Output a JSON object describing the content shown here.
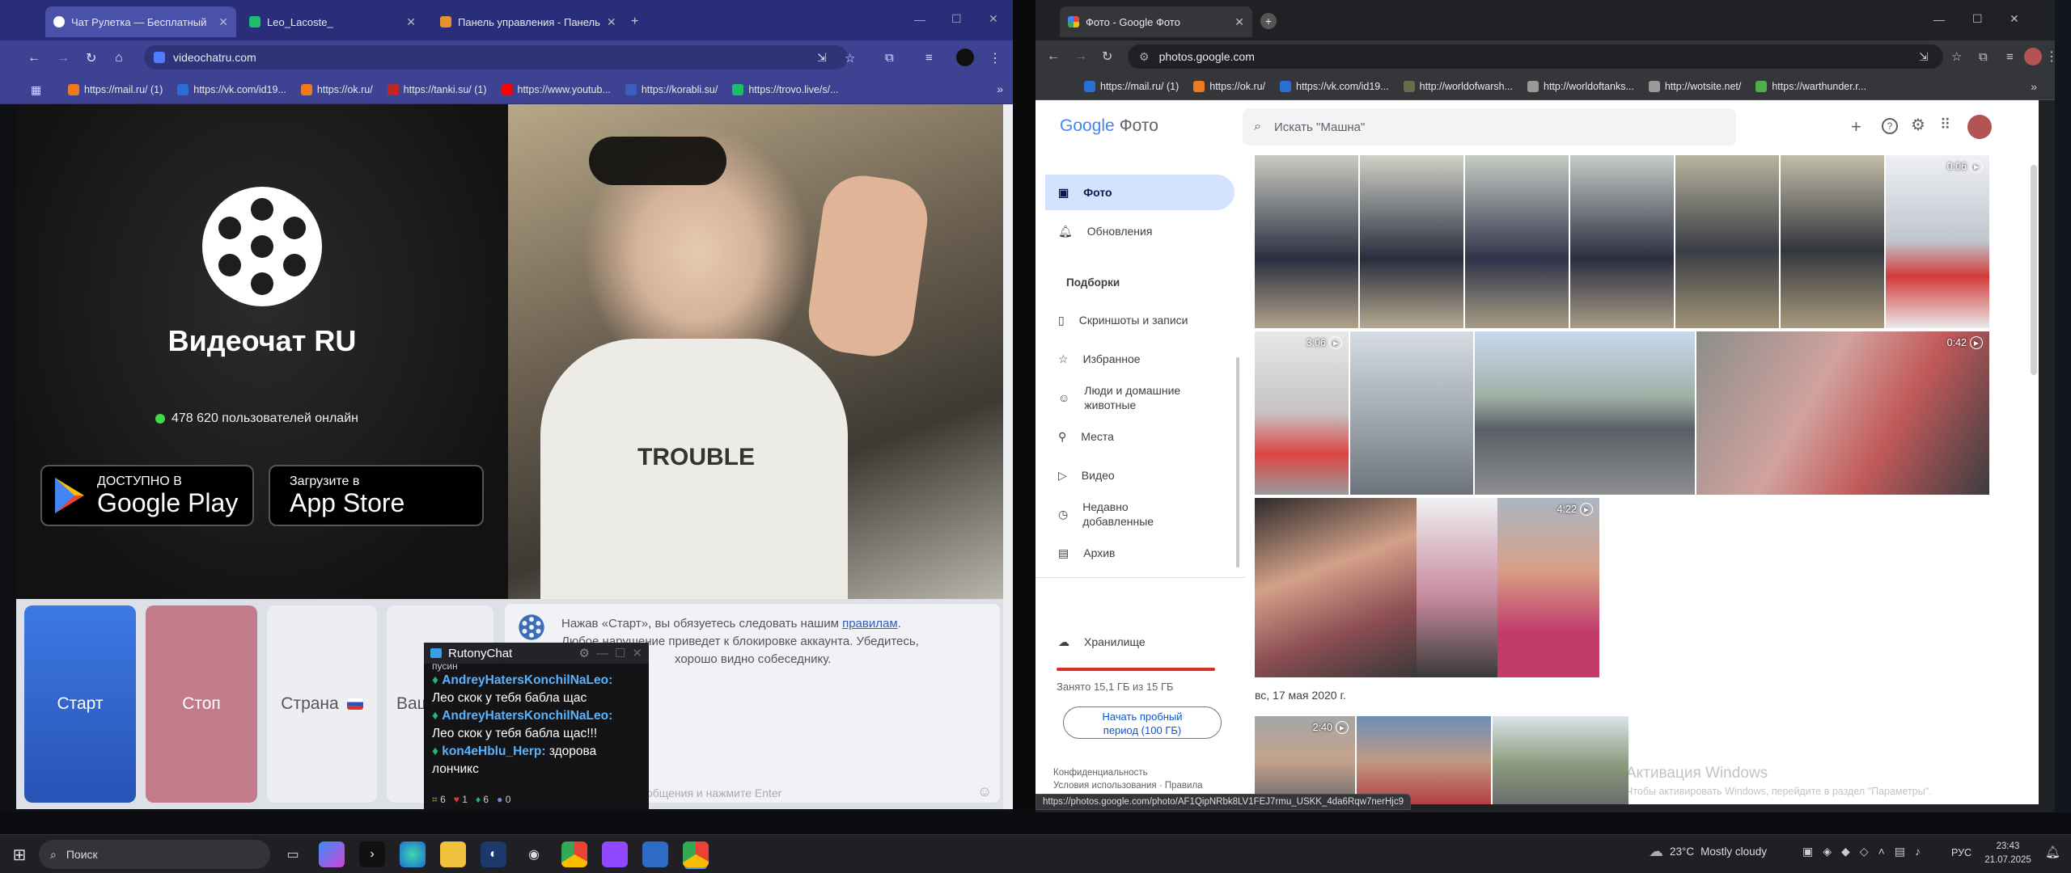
{
  "left_browser": {
    "tabs": [
      {
        "label": "Чат Рулетка — Бесплатный"
      },
      {
        "label": "Leo_Lacoste_"
      },
      {
        "label": "Панель управления - Панель"
      }
    ],
    "url": "videochatru.com",
    "bookmarks": [
      "https://mail.ru/ (1)",
      "https://vk.com/id19...",
      "https://ok.ru/",
      "https://tanki.su/ (1)",
      "https://www.youtub...",
      "https://korabli.su/",
      "https://trovo.live/s/..."
    ],
    "page": {
      "logo_title": "Видеочат RU",
      "online_text": "478 620 пользователей онлайн",
      "google_play": {
        "small": "ДОСТУПНО В",
        "big": "Google Play"
      },
      "app_store": {
        "small": "Загрузите в",
        "big": "App Store"
      },
      "buttons": {
        "start": "Старт",
        "stop": "Стоп",
        "country": "Страна",
        "partial": "Ваш"
      },
      "rules_prefix": "Нажав «Старт», вы обязуетесь следовать нашим ",
      "rules_link": "правилам",
      "rules_line2": "Любое нарушение приведет к блокировке аккаунта. Убедитесь,",
      "rules_line3": "хорошо видно собеседнику.",
      "message_placeholder": "сообщения и нажмите Enter",
      "shirt_text": "TROUBLE"
    }
  },
  "chat": {
    "title": "RutonyChat",
    "cut_top": "пусин",
    "messages": [
      {
        "user": "AndreyHatersKonchilNaLeo:",
        "text": "Лео скок у тебя бабла щас"
      },
      {
        "user": "AndreyHatersKonchilNaLeo:",
        "text": "Лео скок у тебя бабла щас!!!"
      },
      {
        "user": "kon4eHblu_Herp:",
        "text": "здорова лончикс"
      }
    ],
    "stats": [
      "6",
      "1",
      "6",
      "0"
    ]
  },
  "right_browser": {
    "tab": "Фото - Google Фото",
    "url": "photos.google.com",
    "bookmarks": [
      "https://mail.ru/ (1)",
      "https://ok.ru/",
      "https://vk.com/id19...",
      "http://worldofwarsh...",
      "http://worldoftanks...",
      "http://wotsite.net/",
      "https://warthunder.r..."
    ],
    "app_name_google": "Google",
    "app_name_photos": "Фото",
    "search_placeholder": "Искать \"Машна\"",
    "nav": {
      "photos": "Фото",
      "updates": "Обновления",
      "section": "Подборки",
      "screenshots": "Скриншоты и записи",
      "favorites": "Избранное",
      "people_1": "Люди и домашние",
      "people_2": "животные",
      "places": "Места",
      "video": "Видео",
      "recent_1": "Недавно",
      "recent_2": "добавленные",
      "archive": "Архив",
      "storage": "Хранилище",
      "storage_used": "Занято 15,1 ГБ из 15 ГБ",
      "trial_1": "Начать пробный",
      "trial_2": "период (100 ГБ)",
      "privacy": "Конфиденциальность",
      "terms_1": "Условия использования",
      "terms_2": "Правила"
    },
    "durations": {
      "d1": "0:06",
      "d2": "3:06",
      "d3": "0:42",
      "d4": "4:22",
      "d5": "2:40"
    },
    "date_header": "вс, 17 мая 2020 г.",
    "activate_1": "Активация Windows",
    "activate_2": "Чтобы активировать Windows, перейдите в раздел \"Параметры\".",
    "status_url": "https://photos.google.com/photo/AF1QipNRbk8LV1FEJ7rmu_USKK_4da6Rqw7nerHjc9"
  },
  "taskbar": {
    "search": "Поиск",
    "weather_temp": "23°C",
    "weather_desc": "Mostly cloudy",
    "lang": "РУС",
    "time": "23:43",
    "date": "21.07.2025"
  },
  "colors": {
    "left_tab_bar": "#2a2e7a",
    "left_toolbar": "#3d4392",
    "start_btn": "#2f63d6",
    "stop_btn": "#c07a8c",
    "gp_selected": "#d3e3fd"
  }
}
